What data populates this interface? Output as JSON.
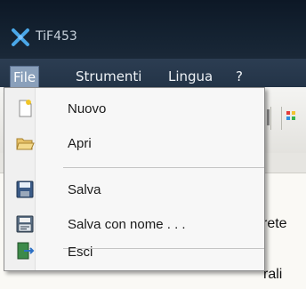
{
  "window": {
    "title": "TiF453"
  },
  "menubar": {
    "items": [
      "File",
      "Strumenti",
      "Lingua",
      "?"
    ]
  },
  "file_menu": {
    "items": [
      {
        "label": "Nuovo",
        "icon": "new-document-icon"
      },
      {
        "label": "Apri",
        "icon": "open-folder-icon"
      },
      {
        "label": "Salva",
        "icon": "save-disk-icon"
      },
      {
        "label": "Salva con nome . . .",
        "icon": "save-as-icon"
      },
      {
        "label": "Esci",
        "icon": "exit-door-icon"
      }
    ]
  },
  "background": {
    "text_1": "rete",
    "text_2": "rali"
  }
}
